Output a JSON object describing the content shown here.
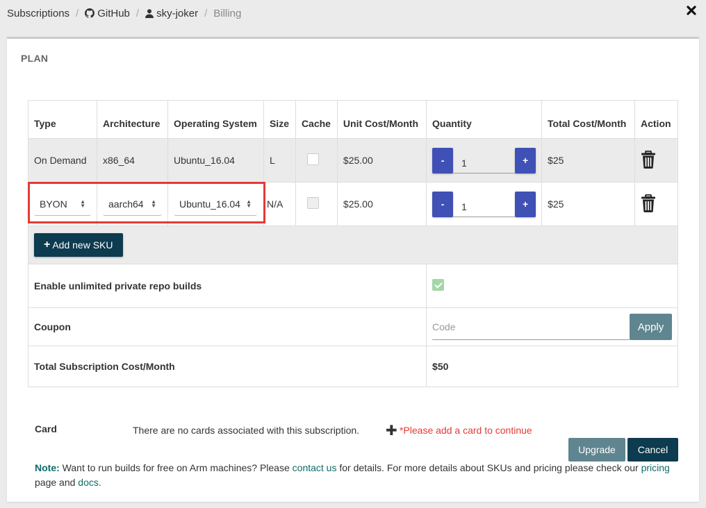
{
  "breadcrumb": {
    "subscriptions": "Subscriptions",
    "github": "GitHub",
    "user": "sky-joker",
    "billing": "Billing"
  },
  "plan": {
    "title": "PLAN",
    "headers": [
      "Type",
      "Architecture",
      "Operating System",
      "Size",
      "Cache",
      "Unit Cost/Month",
      "Quantity",
      "Total Cost/Month",
      "Action"
    ],
    "rows": [
      {
        "type": "On Demand",
        "arch": "x86_64",
        "os": "Ubuntu_16.04",
        "size": "L",
        "cache": false,
        "unit_cost": "$25.00",
        "quantity": "1",
        "total": "$25"
      },
      {
        "type": "BYON",
        "arch": "aarch64",
        "os": "Ubuntu_16.04",
        "size": "N/A",
        "cache": false,
        "unit_cost": "$25.00",
        "quantity": "1",
        "total": "$25"
      }
    ],
    "add_sku_label": "Add new SKU",
    "minus": "-",
    "plus": "+",
    "unlimited_label": "Enable unlimited private repo builds",
    "unlimited_checked": true,
    "coupon_label": "Coupon",
    "coupon_placeholder": "Code",
    "apply_label": "Apply",
    "total_label": "Total Subscription Cost/Month",
    "total_value": "$50"
  },
  "card": {
    "label": "Card",
    "message": "There are no cards associated with this subscription.",
    "warning": "*Please add a card to continue",
    "upgrade_label": "Upgrade",
    "cancel_label": "Cancel"
  },
  "note": {
    "label": "Note:",
    "text1": " Want to run builds for free on Arm machines? Please ",
    "contact_link": "contact us",
    "text2": " for details. For more details about SKUs and pricing please check our ",
    "pricing_link": "pricing",
    "text3": " page and ",
    "docs_link": "docs",
    "text4": "."
  },
  "colors": {
    "primary_dark": "#0d3b4f",
    "qty_button": "#3f51b5",
    "apply_button": "#5f8590",
    "highlight": "#e53935",
    "link": "#0d6b68"
  },
  "icons": [
    "github-icon",
    "user-icon",
    "close-icon",
    "trash-icon",
    "plus-icon",
    "select-arrows-icon",
    "checkbox-icon"
  ]
}
